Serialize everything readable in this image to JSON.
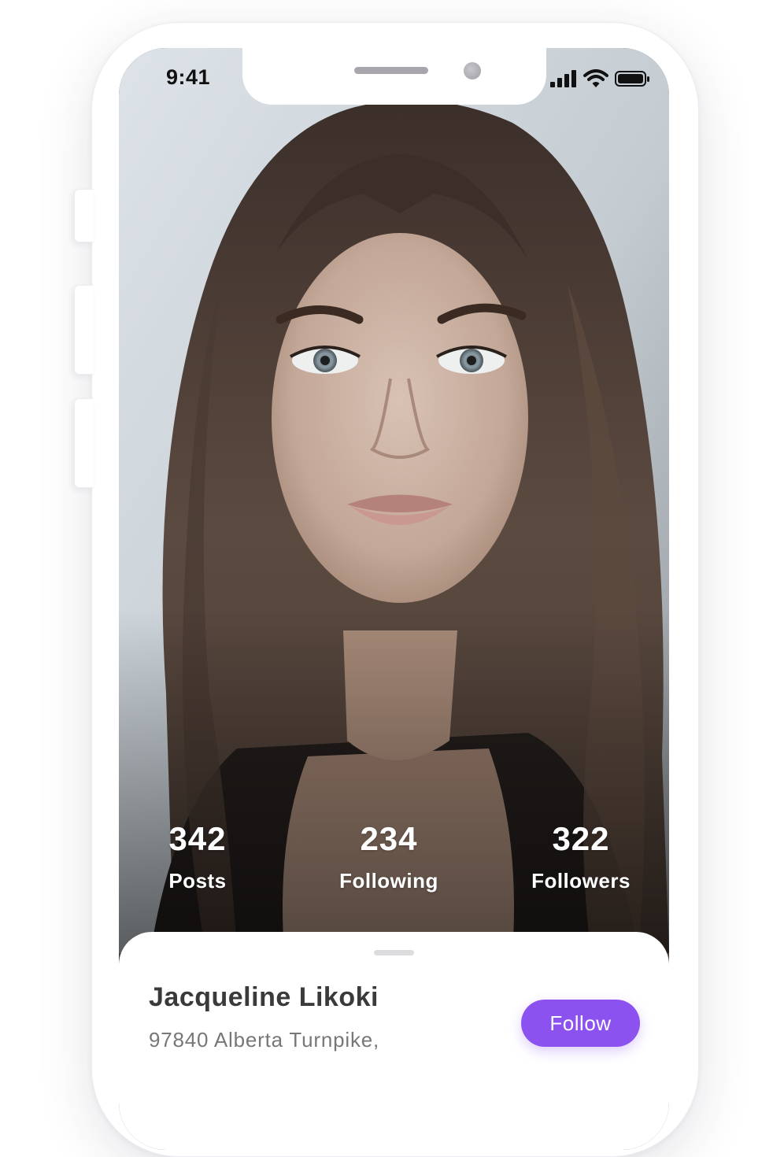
{
  "status_bar": {
    "time": "9:41",
    "icons": [
      "cellular-signal-icon",
      "wifi-icon",
      "battery-icon"
    ]
  },
  "profile": {
    "photo": "portrait-photo",
    "stats": [
      {
        "value": "342",
        "label": "Posts"
      },
      {
        "value": "234",
        "label": "Following"
      },
      {
        "value": "322",
        "label": "Followers"
      }
    ],
    "name": "Jacqueline Likoki",
    "address": "97840 Alberta Turnpike,",
    "follow_label": "Follow"
  },
  "colors": {
    "accent": "#8b52f0",
    "name_text": "#3a3a3a",
    "address_text": "#777777",
    "stat_text": "#ffffff",
    "frame": "#ffffff"
  }
}
